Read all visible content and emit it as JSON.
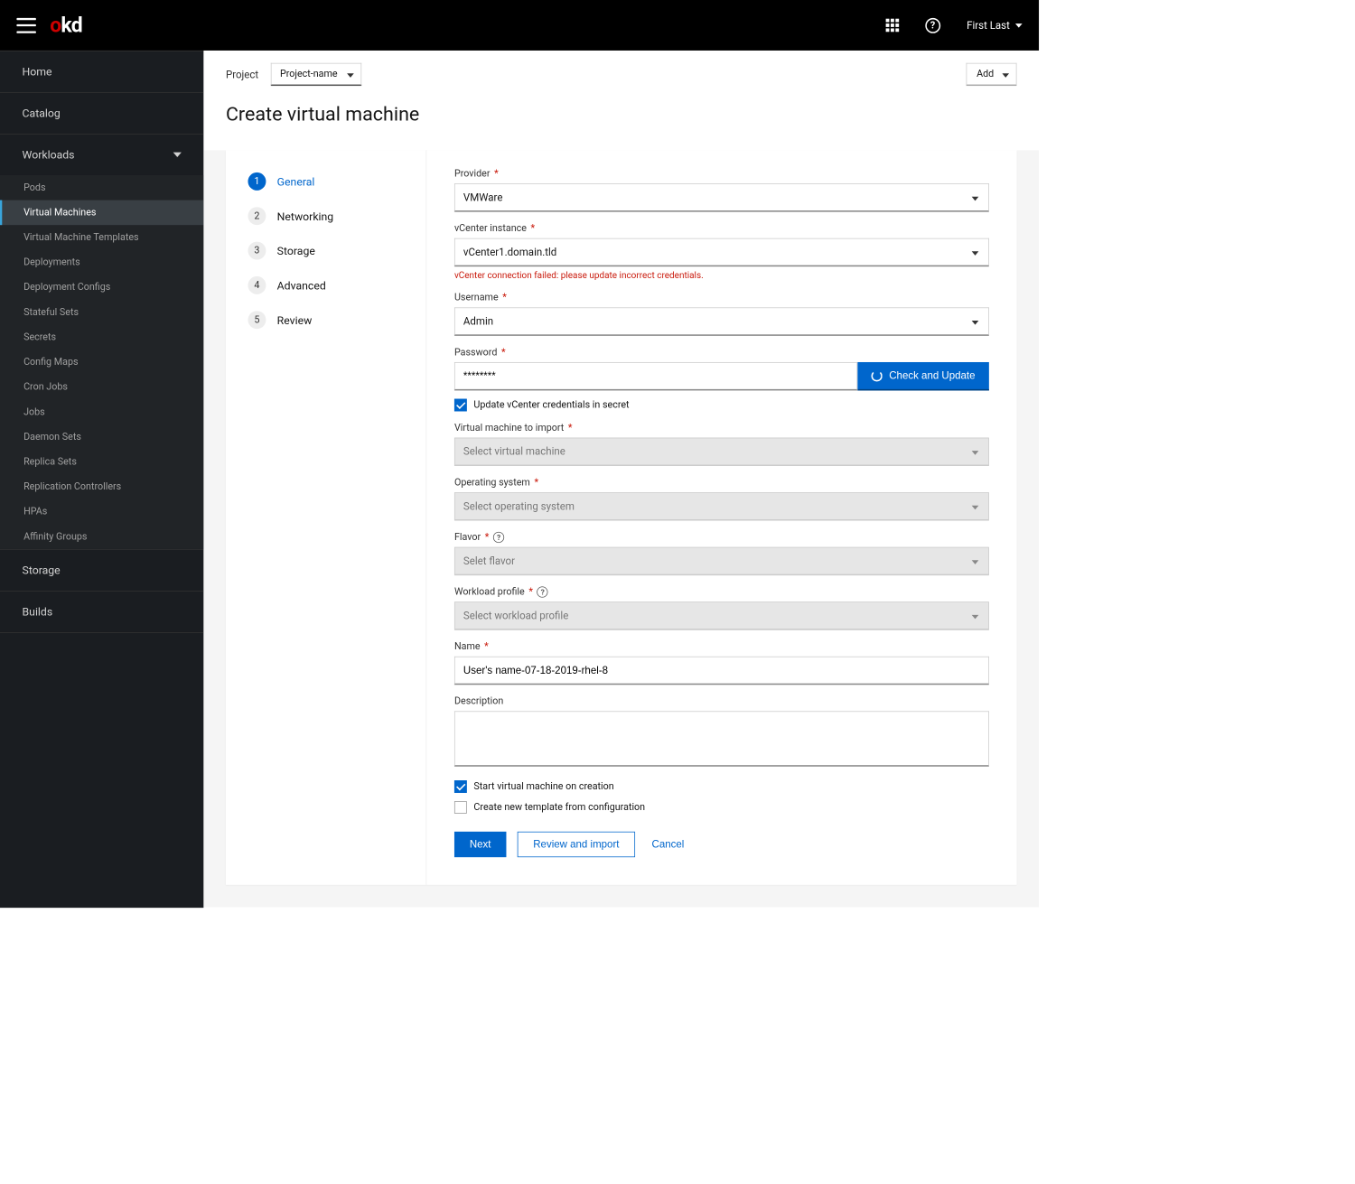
{
  "header": {
    "user": "First Last"
  },
  "sidebar": {
    "home": "Home",
    "catalog": "Catalog",
    "workloads": "Workloads",
    "workloads_items": [
      "Pods",
      "Virtual Machines",
      "Virtual Machine Templates",
      "Deployments",
      "Deployment Configs",
      "Stateful Sets",
      "Secrets",
      "Config Maps",
      "Cron Jobs",
      "Jobs",
      "Daemon Sets",
      "Replica Sets",
      "Replication Controllers",
      "HPAs",
      "Affinity Groups"
    ],
    "storage": "Storage",
    "builds": "Builds"
  },
  "topline": {
    "project_label": "Project",
    "project_value": "Project-name",
    "add_label": "Add"
  },
  "page": {
    "title": "Create virtual machine"
  },
  "steps": [
    {
      "num": "1",
      "label": "General"
    },
    {
      "num": "2",
      "label": "Networking"
    },
    {
      "num": "3",
      "label": "Storage"
    },
    {
      "num": "4",
      "label": "Advanced"
    },
    {
      "num": "5",
      "label": "Review"
    }
  ],
  "form": {
    "provider_label": "Provider",
    "provider_value": "VMWare",
    "vcenter_label": "vCenter instance",
    "vcenter_value": "vCenter1.domain.tld",
    "vcenter_error": "vCenter connection failed: please update incorrect credentials.",
    "username_label": "Username",
    "username_value": "Admin",
    "password_label": "Password",
    "password_value": "********",
    "check_update_label": "Check and Update",
    "update_secret_label": "Update vCenter credentials in secret",
    "vm_import_label": "Virtual machine to import",
    "vm_import_placeholder": "Select virtual machine",
    "os_label": "Operating system",
    "os_placeholder": "Select operating system",
    "flavor_label": "Flavor",
    "flavor_placeholder": "Selet flavor",
    "workload_label": "Workload profile",
    "workload_placeholder": "Select workload profile",
    "name_label": "Name",
    "name_value": "User's name-07-18-2019-rhel-8",
    "desc_label": "Description",
    "start_vm_label": "Start virtual machine on creation",
    "create_template_label": "Create new template from configuration",
    "next": "Next",
    "review": "Review and import",
    "cancel": "Cancel"
  }
}
